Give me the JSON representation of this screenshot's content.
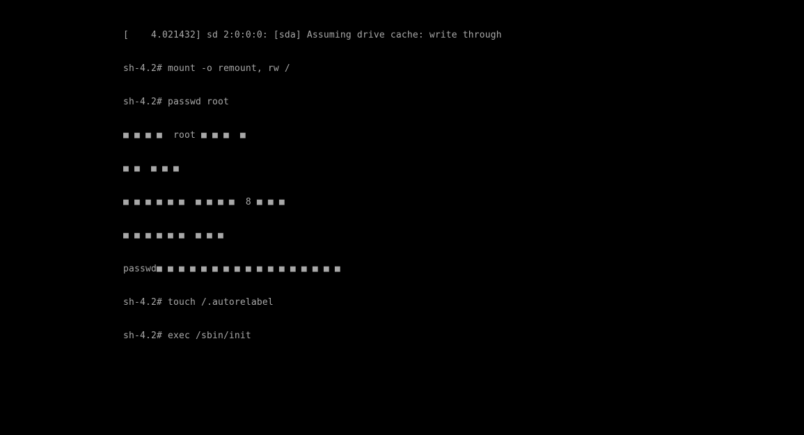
{
  "console": {
    "lines": [
      "[    4.021432] sd 2:0:0:0: [sda] Assuming drive cache: write through",
      "sh-4.2# mount -o remount, rw /",
      "sh-4.2# passwd root",
      "■ ■ ■ ■  root ■ ■ ■  ■",
      "■ ■  ■ ■ ■",
      "■ ■ ■ ■ ■ ■  ■ ■ ■ ■  8 ■ ■ ■",
      "■ ■ ■ ■ ■ ■  ■ ■ ■",
      "passwd■ ■ ■ ■ ■ ■ ■ ■ ■ ■ ■ ■ ■ ■ ■ ■ ■",
      "sh-4.2# touch /.autorelabel",
      "sh-4.2# exec /sbin/init"
    ],
    "text_color": "#a8a8a8",
    "background": "#000000"
  }
}
